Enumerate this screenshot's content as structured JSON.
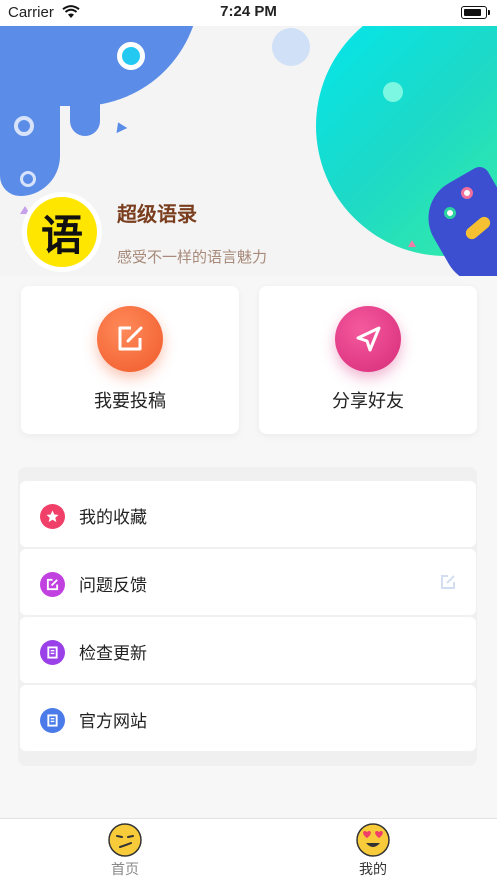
{
  "status_bar": {
    "carrier": "Carrier",
    "time": "7:24 PM"
  },
  "header": {
    "avatar_char": "语",
    "app_title": "超级语录",
    "app_subtitle": "感受不一样的语言魅力"
  },
  "actions": [
    {
      "label": "我要投稿",
      "icon": "edit-icon",
      "color": "#f05a2a"
    },
    {
      "label": "分享好友",
      "icon": "send-icon",
      "color": "#d62b7a"
    }
  ],
  "menu": [
    {
      "label": "我的收藏",
      "icon": "star-icon",
      "color": "#f0406a"
    },
    {
      "label": "问题反馈",
      "icon": "feedback-icon",
      "color": "#c040e0"
    },
    {
      "label": "检查更新",
      "icon": "update-icon",
      "color": "#9a40e8"
    },
    {
      "label": "官方网站",
      "icon": "website-icon",
      "color": "#4a7be8"
    }
  ],
  "tab_bar": [
    {
      "label": "首页",
      "icon": "smirk-face-icon"
    },
    {
      "label": "我的",
      "icon": "heart-eyes-face-icon"
    }
  ]
}
